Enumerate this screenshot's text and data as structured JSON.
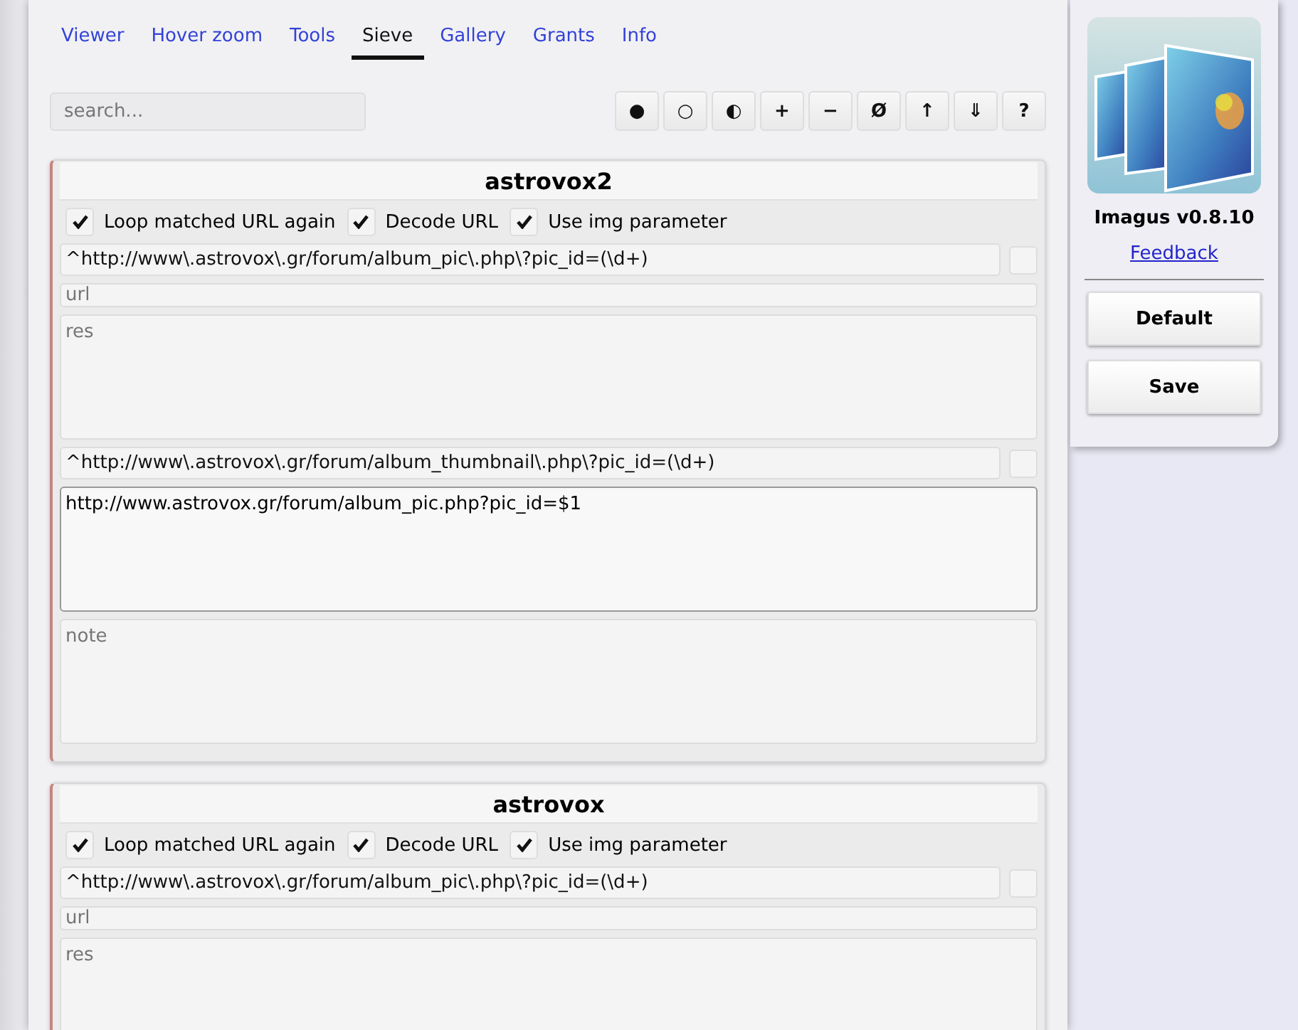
{
  "tabs": [
    {
      "label": "Viewer",
      "selected": false
    },
    {
      "label": "Hover zoom",
      "selected": false
    },
    {
      "label": "Tools",
      "selected": false
    },
    {
      "label": "Sieve",
      "selected": true
    },
    {
      "label": "Gallery",
      "selected": false
    },
    {
      "label": "Grants",
      "selected": false
    },
    {
      "label": "Info",
      "selected": false
    }
  ],
  "search": {
    "placeholder": "search..."
  },
  "toolbar": [
    "●",
    "○",
    "◐",
    "+",
    "−",
    "Ø",
    "↑",
    "⇓",
    "?"
  ],
  "sieves": [
    {
      "name": "astrovox2",
      "options": [
        {
          "label": "Loop matched URL again",
          "checked": true
        },
        {
          "label": "Decode URL",
          "checked": true
        },
        {
          "label": "Use img parameter",
          "checked": true
        }
      ],
      "fields": [
        {
          "kind": "regex",
          "value": "^http://www\\.astrovox\\.gr/forum/album_pic\\.php\\?pic_id=(\\d+)",
          "checked": false
        },
        {
          "kind": "input",
          "placeholder": "url"
        },
        {
          "kind": "textarea",
          "placeholder": "res"
        },
        {
          "kind": "regex",
          "value": "^http://www\\.astrovox\\.gr/forum/album_thumbnail\\.php\\?pic_id=(\\d+)",
          "checked": false
        },
        {
          "kind": "textarea",
          "value": "http://www.astrovox.gr/forum/album_pic.php?pic_id=$1"
        },
        {
          "kind": "textarea",
          "placeholder": "note"
        }
      ]
    },
    {
      "name": "astrovox",
      "options": [
        {
          "label": "Loop matched URL again",
          "checked": true
        },
        {
          "label": "Decode URL",
          "checked": true
        },
        {
          "label": "Use img parameter",
          "checked": true
        }
      ],
      "fields": [
        {
          "kind": "regex",
          "value": "^http://www\\.astrovox\\.gr/forum/album_pic\\.php\\?pic_id=(\\d+)",
          "checked": false
        },
        {
          "kind": "input",
          "placeholder": "url"
        },
        {
          "kind": "textarea",
          "placeholder": "res"
        }
      ]
    }
  ],
  "sidebar": {
    "title": "Imagus v0.8.10",
    "link": "Feedback",
    "buttons": [
      "Default",
      "Save"
    ]
  }
}
